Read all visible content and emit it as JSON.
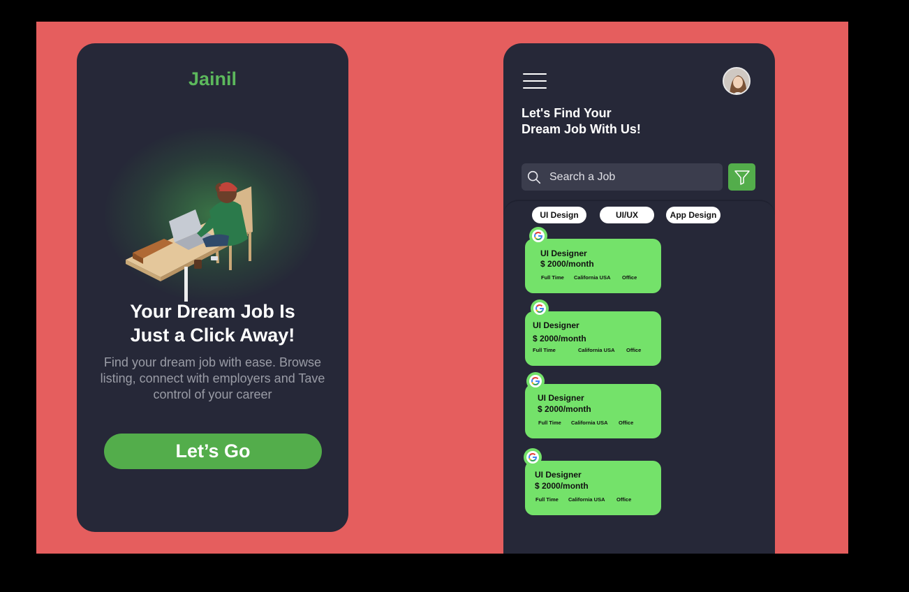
{
  "onboarding": {
    "brand": "Jainil",
    "headline_line1": "Your Dream Job Is",
    "headline_line2": "Just a Click Away!",
    "subtext": "Find your dream job with ease. Browse listing, connect with employers and Tave control of your career",
    "cta_label": "Let’s Go"
  },
  "home": {
    "title_line1": "Let's Find Your",
    "title_line2": "Dream Job With Us!",
    "search": {
      "placeholder": "Search a Job"
    },
    "chips": [
      "UI Design",
      "UI/UX",
      "App Design"
    ],
    "jobs": [
      {
        "role": "UI Designer",
        "salary": "$ 2000/month",
        "tags": [
          "Full Time",
          "California USA",
          "Office"
        ]
      },
      {
        "role": "UI Designer",
        "salary": "$ 2000/month",
        "tags": [
          "Full Time",
          "California USA",
          "Office"
        ]
      },
      {
        "role": "UI Designer",
        "salary": "$ 2000/month",
        "tags": [
          "Full Time",
          "California USA",
          "Office"
        ]
      },
      {
        "role": "UI Designer",
        "salary": "$ 2000/month",
        "tags": [
          "Full Time",
          "California USA",
          "Office"
        ]
      }
    ]
  },
  "colors": {
    "background": "#e55e5e",
    "phone": "#262838",
    "accent_green": "#53ad4b",
    "card_green": "#74e26a"
  },
  "icons": [
    "menu-icon",
    "search-icon",
    "filter-icon",
    "google-logo-icon"
  ]
}
